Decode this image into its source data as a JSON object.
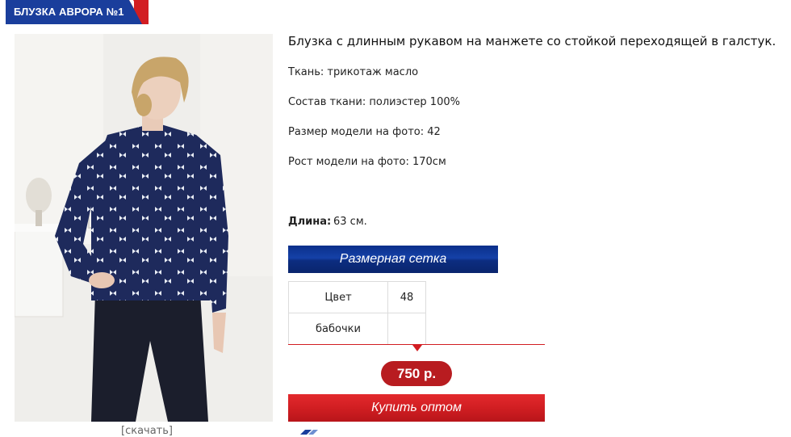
{
  "header": {
    "title": "БЛУЗКА АВРОРА №1"
  },
  "product": {
    "description": "Блузка с длинным рукавом на манжете со стойкой переходящей в галстук.",
    "attributes": [
      "Ткань: трикотаж масло",
      "Состав ткани: полиэстер 100%",
      "Размер модели на фото: 42",
      "Рост модели на фото: 170см"
    ],
    "length_label": "Длина:",
    "length_value": "63 см.",
    "download_label": "[скачать]"
  },
  "size_chart_button": "Размерная сетка",
  "sizes_table": {
    "header": [
      "Цвет",
      "48"
    ],
    "rows": [
      [
        "бабочки",
        ""
      ]
    ]
  },
  "price": "750 р.",
  "buy_button": "Купить оптом",
  "colors": {
    "brand_blue": "#1a3e9c",
    "brand_red": "#d21d22",
    "price_red": "#b81c20"
  }
}
